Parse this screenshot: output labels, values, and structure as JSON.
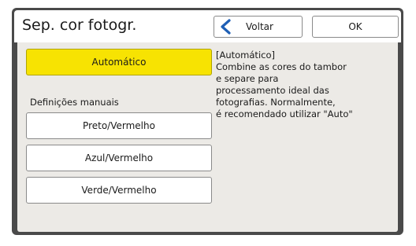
{
  "header": {
    "title": "Sep. cor fotogr.",
    "back_label": "Voltar",
    "ok_label": "OK"
  },
  "options": {
    "auto": "Automático",
    "manual_section_label": "Definições manuais",
    "manual": [
      "Preto/Vermelho",
      "Azul/Vermelho",
      "Verde/Vermelho"
    ]
  },
  "description": {
    "title": "[Automático]",
    "body": "Combine as cores do tambor\ne separe para\nprocessamento ideal das\nfotografias. Normalmente,\né recomendado utilizar \"Auto\""
  },
  "colors": {
    "selected": "#f7e302",
    "back_chevron": "#1f5fb5",
    "frame": "#4a4a4a",
    "panel": "#eceae6"
  },
  "icons": {
    "back": "chevron-left-icon"
  }
}
